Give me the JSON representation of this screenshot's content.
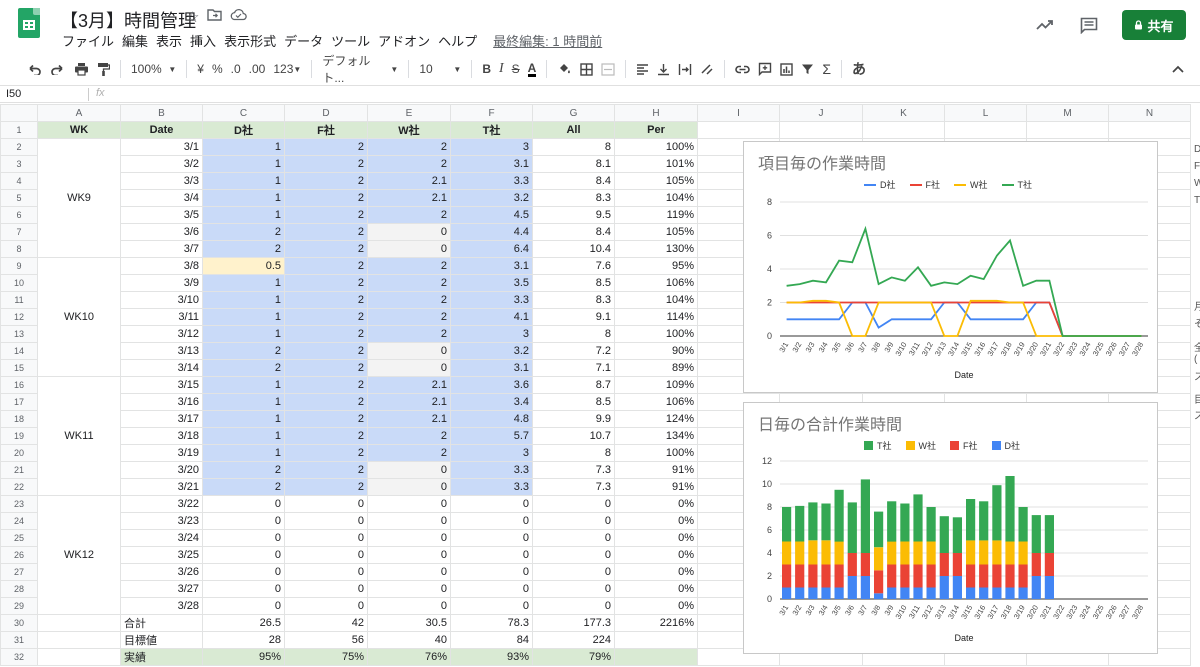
{
  "header": {
    "doc_title": "【3月】時間管理",
    "menu": [
      "ファイル",
      "編集",
      "表示",
      "挿入",
      "表示形式",
      "データ",
      "ツール",
      "アドオン",
      "ヘルプ"
    ],
    "last_edit": "最終編集: 1 時間前",
    "share_label": "共有"
  },
  "toolbar": {
    "zoom": "100%",
    "currency": "¥",
    "percent": "%",
    "dec_less": ".0",
    "dec_more": ".00",
    "format_more": "123",
    "font": "デフォルト...",
    "font_size": "10",
    "bold": "B",
    "italic": "I",
    "strike": "S",
    "text_color": "A",
    "input_tools": "あ"
  },
  "formula_bar": {
    "cell_ref": "I50",
    "fx": "fx",
    "value": ""
  },
  "columns": [
    "A",
    "B",
    "C",
    "D",
    "E",
    "F",
    "G",
    "H",
    "I",
    "J",
    "K",
    "L",
    "M",
    "N"
  ],
  "table_header": [
    "WK",
    "Date",
    "D社",
    "F社",
    "W社",
    "T社",
    "All",
    "Per"
  ],
  "weeks": [
    "WK9",
    "WK10",
    "WK11",
    "WK12"
  ],
  "rows": [
    {
      "date": "3/1",
      "d": "1",
      "f": "2",
      "w": "2",
      "t": "3",
      "all": "8",
      "per": "100%"
    },
    {
      "date": "3/2",
      "d": "1",
      "f": "2",
      "w": "2",
      "t": "3.1",
      "all": "8.1",
      "per": "101%"
    },
    {
      "date": "3/3",
      "d": "1",
      "f": "2",
      "w": "2.1",
      "t": "3.3",
      "all": "8.4",
      "per": "105%"
    },
    {
      "date": "3/4",
      "d": "1",
      "f": "2",
      "w": "2.1",
      "t": "3.2",
      "all": "8.3",
      "per": "104%"
    },
    {
      "date": "3/5",
      "d": "1",
      "f": "2",
      "w": "2",
      "t": "4.5",
      "all": "9.5",
      "per": "119%"
    },
    {
      "date": "3/6",
      "d": "2",
      "f": "2",
      "w": "0",
      "t": "4.4",
      "all": "8.4",
      "per": "105%"
    },
    {
      "date": "3/7",
      "d": "2",
      "f": "2",
      "w": "0",
      "t": "6.4",
      "all": "10.4",
      "per": "130%"
    },
    {
      "date": "3/8",
      "d": "0.5",
      "f": "2",
      "w": "2",
      "t": "3.1",
      "all": "7.6",
      "per": "95%"
    },
    {
      "date": "3/9",
      "d": "1",
      "f": "2",
      "w": "2",
      "t": "3.5",
      "all": "8.5",
      "per": "106%"
    },
    {
      "date": "3/10",
      "d": "1",
      "f": "2",
      "w": "2",
      "t": "3.3",
      "all": "8.3",
      "per": "104%"
    },
    {
      "date": "3/11",
      "d": "1",
      "f": "2",
      "w": "2",
      "t": "4.1",
      "all": "9.1",
      "per": "114%"
    },
    {
      "date": "3/12",
      "d": "1",
      "f": "2",
      "w": "2",
      "t": "3",
      "all": "8",
      "per": "100%"
    },
    {
      "date": "3/13",
      "d": "2",
      "f": "2",
      "w": "0",
      "t": "3.2",
      "all": "7.2",
      "per": "90%"
    },
    {
      "date": "3/14",
      "d": "2",
      "f": "2",
      "w": "0",
      "t": "3.1",
      "all": "7.1",
      "per": "89%"
    },
    {
      "date": "3/15",
      "d": "1",
      "f": "2",
      "w": "2.1",
      "t": "3.6",
      "all": "8.7",
      "per": "109%"
    },
    {
      "date": "3/16",
      "d": "1",
      "f": "2",
      "w": "2.1",
      "t": "3.4",
      "all": "8.5",
      "per": "106%"
    },
    {
      "date": "3/17",
      "d": "1",
      "f": "2",
      "w": "2.1",
      "t": "4.8",
      "all": "9.9",
      "per": "124%"
    },
    {
      "date": "3/18",
      "d": "1",
      "f": "2",
      "w": "2",
      "t": "5.7",
      "all": "10.7",
      "per": "134%"
    },
    {
      "date": "3/19",
      "d": "1",
      "f": "2",
      "w": "2",
      "t": "3",
      "all": "8",
      "per": "100%"
    },
    {
      "date": "3/20",
      "d": "2",
      "f": "2",
      "w": "0",
      "t": "3.3",
      "all": "7.3",
      "per": "91%"
    },
    {
      "date": "3/21",
      "d": "2",
      "f": "2",
      "w": "0",
      "t": "3.3",
      "all": "7.3",
      "per": "91%"
    },
    {
      "date": "3/22",
      "d": "0",
      "f": "0",
      "w": "0",
      "t": "0",
      "all": "0",
      "per": "0%"
    },
    {
      "date": "3/23",
      "d": "0",
      "f": "0",
      "w": "0",
      "t": "0",
      "all": "0",
      "per": "0%"
    },
    {
      "date": "3/24",
      "d": "0",
      "f": "0",
      "w": "0",
      "t": "0",
      "all": "0",
      "per": "0%"
    },
    {
      "date": "3/25",
      "d": "0",
      "f": "0",
      "w": "0",
      "t": "0",
      "all": "0",
      "per": "0%"
    },
    {
      "date": "3/26",
      "d": "0",
      "f": "0",
      "w": "0",
      "t": "0",
      "all": "0",
      "per": "0%"
    },
    {
      "date": "3/27",
      "d": "0",
      "f": "0",
      "w": "0",
      "t": "0",
      "all": "0",
      "per": "0%"
    },
    {
      "date": "3/28",
      "d": "0",
      "f": "0",
      "w": "0",
      "t": "0",
      "all": "0",
      "per": "0%"
    }
  ],
  "summary": [
    {
      "label": "合計",
      "d": "26.5",
      "f": "42",
      "w": "30.5",
      "t": "78.3",
      "all": "177.3",
      "per": "2216%"
    },
    {
      "label": "目標値",
      "d": "28",
      "f": "56",
      "w": "40",
      "t": "84",
      "all": "224",
      "per": ""
    },
    {
      "label": "実績",
      "d": "95%",
      "f": "75%",
      "w": "76%",
      "t": "93%",
      "all": "79%",
      "per": ""
    }
  ],
  "side_text": [
    "D",
    "F",
    "W",
    "T",
    "月",
    "そ",
    "全",
    "(",
    "ス",
    "目",
    "ス"
  ],
  "colors": {
    "d": "#4285f4",
    "f": "#ea4335",
    "w": "#fbbc04",
    "t": "#34a853",
    "share": "#188038"
  },
  "chart_data": [
    {
      "type": "line",
      "title": "項目毎の作業時間",
      "xlabel": "Date",
      "ylabel": "",
      "ylim": [
        0,
        8
      ],
      "yticks": [
        "0",
        "2",
        "4",
        "6",
        "8"
      ],
      "legend_position": "top",
      "x": [
        "3/1",
        "3/2",
        "3/3",
        "3/4",
        "3/5",
        "3/6",
        "3/7",
        "3/8",
        "3/9",
        "3/10",
        "3/11",
        "3/12",
        "3/13",
        "3/14",
        "3/15",
        "3/16",
        "3/17",
        "3/18",
        "3/19",
        "3/20",
        "3/21",
        "3/22",
        "3/23",
        "3/24",
        "3/25",
        "3/26",
        "3/27",
        "3/28"
      ],
      "series": [
        {
          "name": "D社",
          "color": "#4285f4",
          "values": [
            1,
            1,
            1,
            1,
            1,
            2,
            2,
            0.5,
            1,
            1,
            1,
            1,
            2,
            2,
            1,
            1,
            1,
            1,
            1,
            2,
            2,
            0,
            0,
            0,
            0,
            0,
            0,
            0
          ]
        },
        {
          "name": "F社",
          "color": "#ea4335",
          "values": [
            2,
            2,
            2,
            2,
            2,
            2,
            2,
            2,
            2,
            2,
            2,
            2,
            2,
            2,
            2,
            2,
            2,
            2,
            2,
            2,
            2,
            0,
            0,
            0,
            0,
            0,
            0,
            0
          ]
        },
        {
          "name": "W社",
          "color": "#fbbc04",
          "values": [
            2,
            2,
            2.1,
            2.1,
            2,
            0,
            0,
            2,
            2,
            2,
            2,
            2,
            0,
            0,
            2.1,
            2.1,
            2.1,
            2,
            2,
            0,
            0,
            0,
            0,
            0,
            0,
            0,
            0,
            0
          ]
        },
        {
          "name": "T社",
          "color": "#34a853",
          "values": [
            3,
            3.1,
            3.3,
            3.2,
            4.5,
            4.4,
            6.4,
            3.1,
            3.5,
            3.3,
            4.1,
            3,
            3.2,
            3.1,
            3.6,
            3.4,
            4.8,
            5.7,
            3,
            3.3,
            3.3,
            0,
            0,
            0,
            0,
            0,
            0,
            0
          ]
        }
      ]
    },
    {
      "type": "bar",
      "stacked": true,
      "title": "日毎の合計作業時間",
      "xlabel": "Date",
      "ylabel": "",
      "ylim": [
        0,
        12
      ],
      "yticks": [
        "0",
        "2",
        "4",
        "6",
        "8",
        "10",
        "12"
      ],
      "legend_position": "top",
      "x": [
        "3/1",
        "3/2",
        "3/3",
        "3/4",
        "3/5",
        "3/6",
        "3/7",
        "3/8",
        "3/9",
        "3/10",
        "3/11",
        "3/12",
        "3/13",
        "3/14",
        "3/15",
        "3/16",
        "3/17",
        "3/18",
        "3/19",
        "3/20",
        "3/21",
        "3/22",
        "3/23",
        "3/24",
        "3/25",
        "3/26",
        "3/27",
        "3/28"
      ],
      "series": [
        {
          "name": "T社",
          "color": "#34a853",
          "values": [
            3,
            3.1,
            3.3,
            3.2,
            4.5,
            4.4,
            6.4,
            3.1,
            3.5,
            3.3,
            4.1,
            3,
            3.2,
            3.1,
            3.6,
            3.4,
            4.8,
            5.7,
            3,
            3.3,
            3.3,
            0,
            0,
            0,
            0,
            0,
            0,
            0
          ]
        },
        {
          "name": "W社",
          "color": "#fbbc04",
          "values": [
            2,
            2,
            2.1,
            2.1,
            2,
            0,
            0,
            2,
            2,
            2,
            2,
            2,
            0,
            0,
            2.1,
            2.1,
            2.1,
            2,
            2,
            0,
            0,
            0,
            0,
            0,
            0,
            0,
            0,
            0
          ]
        },
        {
          "name": "F社",
          "color": "#ea4335",
          "values": [
            2,
            2,
            2,
            2,
            2,
            2,
            2,
            2,
            2,
            2,
            2,
            2,
            2,
            2,
            2,
            2,
            2,
            2,
            2,
            2,
            2,
            0,
            0,
            0,
            0,
            0,
            0,
            0
          ]
        },
        {
          "name": "D社",
          "color": "#4285f4",
          "values": [
            1,
            1,
            1,
            1,
            1,
            2,
            2,
            0.5,
            1,
            1,
            1,
            1,
            2,
            2,
            1,
            1,
            1,
            1,
            1,
            2,
            2,
            0,
            0,
            0,
            0,
            0,
            0,
            0
          ]
        }
      ]
    }
  ]
}
